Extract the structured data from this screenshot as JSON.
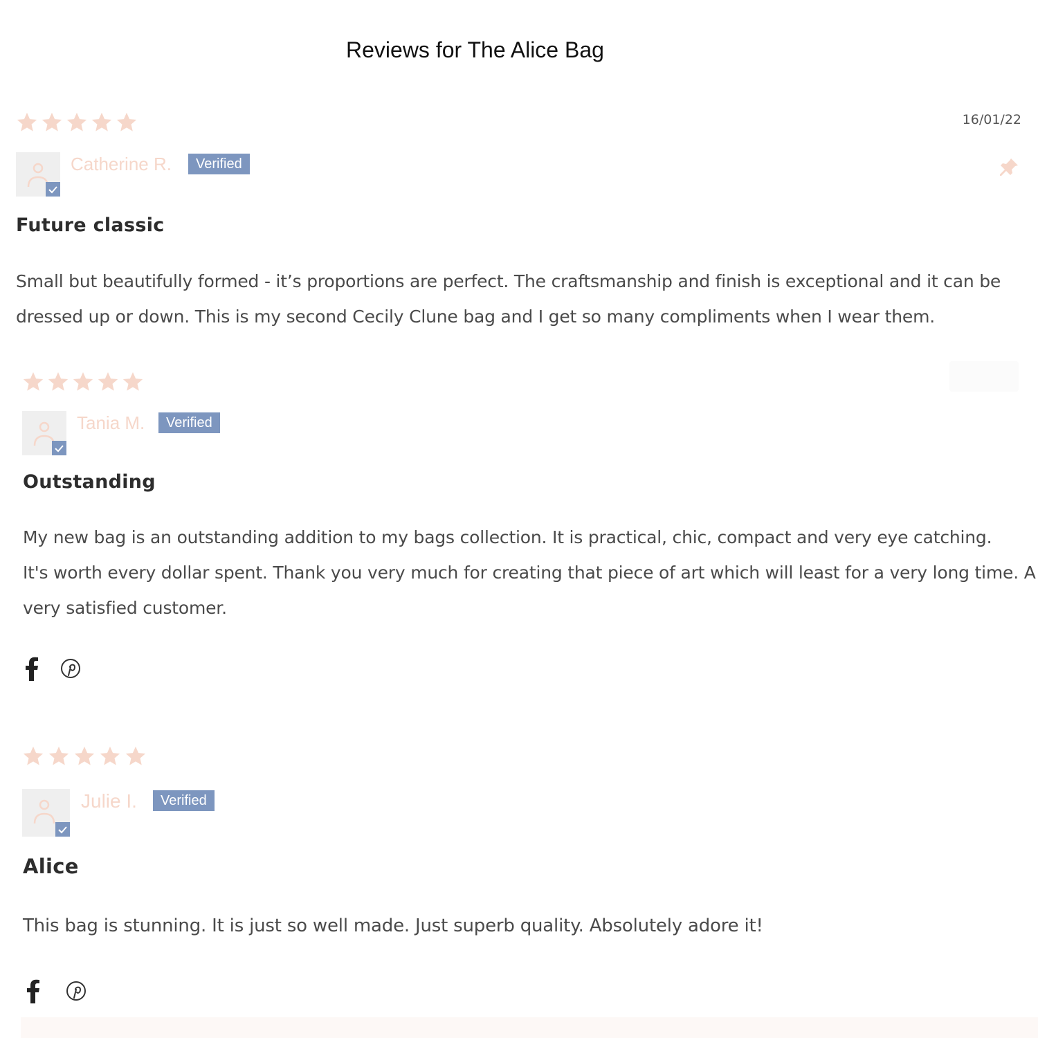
{
  "page_title": "Reviews for The Alice Bag",
  "colors": {
    "star": "#f6d7ca",
    "author": "#f6d7ca",
    "verified_badge": "#7d96bf",
    "avatar_bg": "#efefef",
    "title_text": "#2d2d2d",
    "body_text": "#4a4a4a"
  },
  "reviews": [
    {
      "rating": 5,
      "date": "16/01/22",
      "author": "Catherine R.",
      "badge": "Verified",
      "title": "Future classic",
      "body_lines": [
        "Small but beautifully formed - it’s proportions are perfect. The craftsmanship and finish is exceptional and it can be",
        "dressed up or down. This is my second Cecily Clune bag and I get so many compliments when I wear them."
      ],
      "pinned_icon": "pin-icon"
    },
    {
      "rating": 5,
      "author": "Tania M.",
      "badge": "Verified",
      "title": "Outstanding",
      "body_lines": [
        "My new bag is an outstanding addition to my bags collection. It is practical, chic, compact and very eye catching.",
        "It's worth every dollar spent. Thank you very much for creating that piece of art which will least for a very long time. A",
        "very satisfied customer."
      ],
      "share_icons": [
        "facebook-icon",
        "pinterest-icon"
      ]
    },
    {
      "rating": 5,
      "author": "Julie I.",
      "badge": "Verified",
      "title": "Alice",
      "body_lines": [
        "This bag is stunning. It is just so well made. Just superb quality. Absolutely adore it!"
      ],
      "share_icons": [
        "facebook-icon",
        "pinterest-icon"
      ]
    }
  ]
}
